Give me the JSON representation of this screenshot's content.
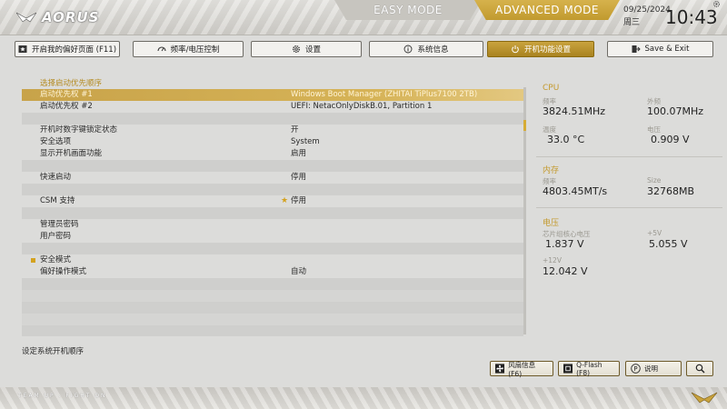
{
  "brand": {
    "logo_text": "AORUS"
  },
  "modes": {
    "easy": "EASY MODE",
    "advanced": "ADVANCED MODE"
  },
  "clock": {
    "date": "09/25/2024",
    "weekday": "周三",
    "time": "10:43"
  },
  "tabs": [
    {
      "label": "开启我的偏好页面 (F11)",
      "icon": "star-icon"
    },
    {
      "label": "频率/电压控制",
      "icon": "speedometer-icon"
    },
    {
      "label": "设置",
      "icon": "gear-icon"
    },
    {
      "label": "系统信息",
      "icon": "info-icon"
    },
    {
      "label": "开机功能设置",
      "icon": "power-icon"
    },
    {
      "label": "Save & Exit",
      "icon": "exit-icon"
    }
  ],
  "main": {
    "header": "选择启动优先顺序",
    "rows": [
      {
        "label": "启动优先权 #1",
        "value": "Windows Boot Manager (ZHITAI TiPlus7100 2TB)"
      },
      {
        "label": "启动优先权 #2",
        "value": "UEFI: NetacOnlyDiskB.01, Partition 1"
      },
      {
        "label": "开机时数字键锁定状态",
        "value": "开"
      },
      {
        "label": "安全选项",
        "value": "System"
      },
      {
        "label": "显示开机画面功能",
        "value": "启用"
      },
      {
        "label": "快速启动",
        "value": "停用"
      },
      {
        "label": "CSM 支持",
        "value": "停用"
      },
      {
        "label": "管理员密码",
        "value": ""
      },
      {
        "label": "用户密码",
        "value": ""
      },
      {
        "label": "安全模式",
        "value": ""
      },
      {
        "label": "偏好操作模式",
        "value": "自动"
      }
    ]
  },
  "info_panel": {
    "cpu": {
      "title": "CPU",
      "freq_label": "频率",
      "freq": "3824.51MHz",
      "ext_label": "外频",
      "ext": "100.07MHz",
      "temp_label": "温度",
      "temp": "33.0 °C",
      "volt_label": "电压",
      "volt": "0.909 V"
    },
    "memory": {
      "title": "内存",
      "freq_label": "频率",
      "freq": "4803.45MT/s",
      "size_label": "Size",
      "size": "32768MB"
    },
    "voltage": {
      "title": "电压",
      "chipset_label": "芯片组核心电压",
      "chipset": "1.837 V",
      "p5v_label": "+5V",
      "p5v": "5.055 V",
      "p12v_label": "+12V",
      "p12v": "12.042 V"
    }
  },
  "hint": "设定系统开机顺序",
  "bottom_buttons": [
    {
      "label": "风扇信息 (F6)",
      "icon": "fan-icon"
    },
    {
      "label": "Q-Flash (F8)",
      "icon": "chip-icon"
    },
    {
      "label": "说明",
      "icon": "help-icon"
    },
    {
      "label": "",
      "icon": "search-icon"
    }
  ],
  "footer": {
    "slogan": "TEAM UP . FIGHT ON"
  },
  "colors": {
    "accent": "#c9a33e",
    "background": "#dcdcda"
  }
}
